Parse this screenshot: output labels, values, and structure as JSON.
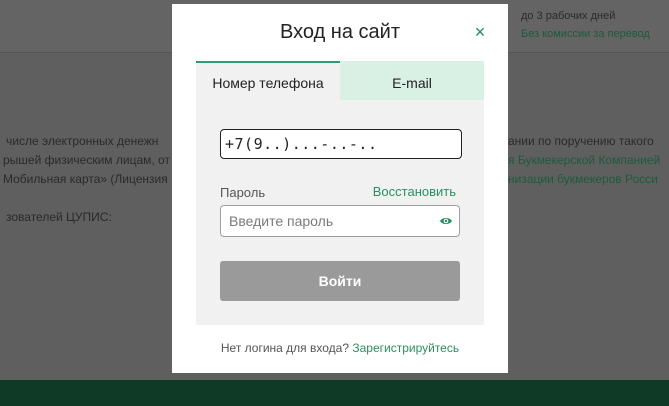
{
  "background": {
    "header_line1": "до 3 рабочих дней",
    "header_line2": "Без комиссии за перевод",
    "left_lines": [
      "числе электронных денежн",
      "рышей физическим лицам, от",
      "Мобильная карта» (Лицензия",
      "зователей ЦУПИС:"
    ],
    "right_lines": [
      "ании по поручению такого",
      "я Букмекерской Компанией",
      "низации букмекеров Росси"
    ]
  },
  "modal": {
    "title": "Вход на сайт",
    "close_symbol": "×",
    "tabs": [
      {
        "label": "Номер телефона",
        "active": true
      },
      {
        "label": "E-mail",
        "active": false
      }
    ],
    "phone_value": "+7(9..)...-..-..",
    "password_label": "Пароль",
    "restore_label": "Восстановить",
    "password_placeholder": "Введите пароль",
    "password_icon": "eye-icon",
    "submit_label": "Войти",
    "register_prompt": "Нет логина для входа?",
    "register_link": "Зарегистрируйтесь"
  },
  "colors": {
    "accent": "#2b8f62",
    "tab_inactive_bg": "#d9f0e5",
    "button_disabled": "#9a9a9a",
    "footer": "#0f3b26"
  }
}
